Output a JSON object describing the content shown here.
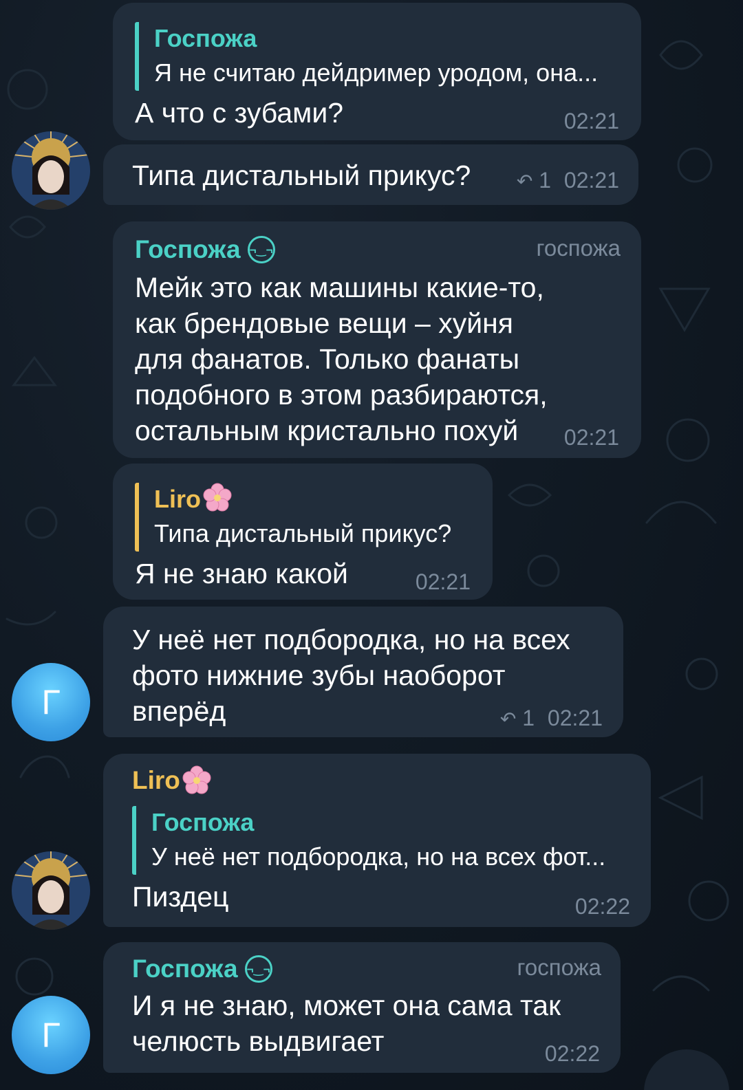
{
  "messages": [
    {
      "reply_to": {
        "name": "Госпожа",
        "text": "Я не считаю дейдример уродом, она..."
      },
      "text": "А что с зубами?",
      "time": "02:21"
    },
    {
      "text": "Типа дистальный прикус?",
      "replies": "1",
      "time": "02:21"
    },
    {
      "sender": "Госпожа",
      "rank": "госпожа",
      "lines": [
        "Мейк это как машины какие-то,",
        "как брендовые вещи – хуйня",
        "для фанатов. Только фанаты",
        "подобного в этом разбираются,",
        "остальным кристально похуй"
      ],
      "time": "02:21"
    },
    {
      "reply_to": {
        "name": "Liro",
        "text": "Типа дистальный прикус?"
      },
      "text": "Я не знаю какой",
      "time": "02:21"
    },
    {
      "lines": [
        "У неё нет подбородка, но на всех",
        "фото нижние зубы наоборот",
        "вперёд"
      ],
      "replies": "1",
      "time": "02:21"
    },
    {
      "sender": "Liro",
      "reply_to": {
        "name": "Госпожа",
        "text": "У неё нет подбородка, но на всех фот..."
      },
      "text": "Пиздец",
      "time": "02:22"
    },
    {
      "sender": "Госпожа",
      "rank": "госпожа",
      "lines": [
        "И я не знаю, может она сама так",
        "челюсть выдвигает"
      ],
      "time": "02:22"
    }
  ],
  "avatars": {
    "letter": "Г"
  },
  "icons": {
    "reply": "reply-arrow-icon",
    "sender_emoji": "smirk-emoji-icon",
    "flower": "cherry-blossom-icon"
  },
  "colors": {
    "background": "#0f1620",
    "bubble": "#212d3b",
    "teal_name": "#4bd1c6",
    "orange_name": "#efc055",
    "time": "#7b8a9b",
    "avatar_blue": "#3da1e6"
  }
}
